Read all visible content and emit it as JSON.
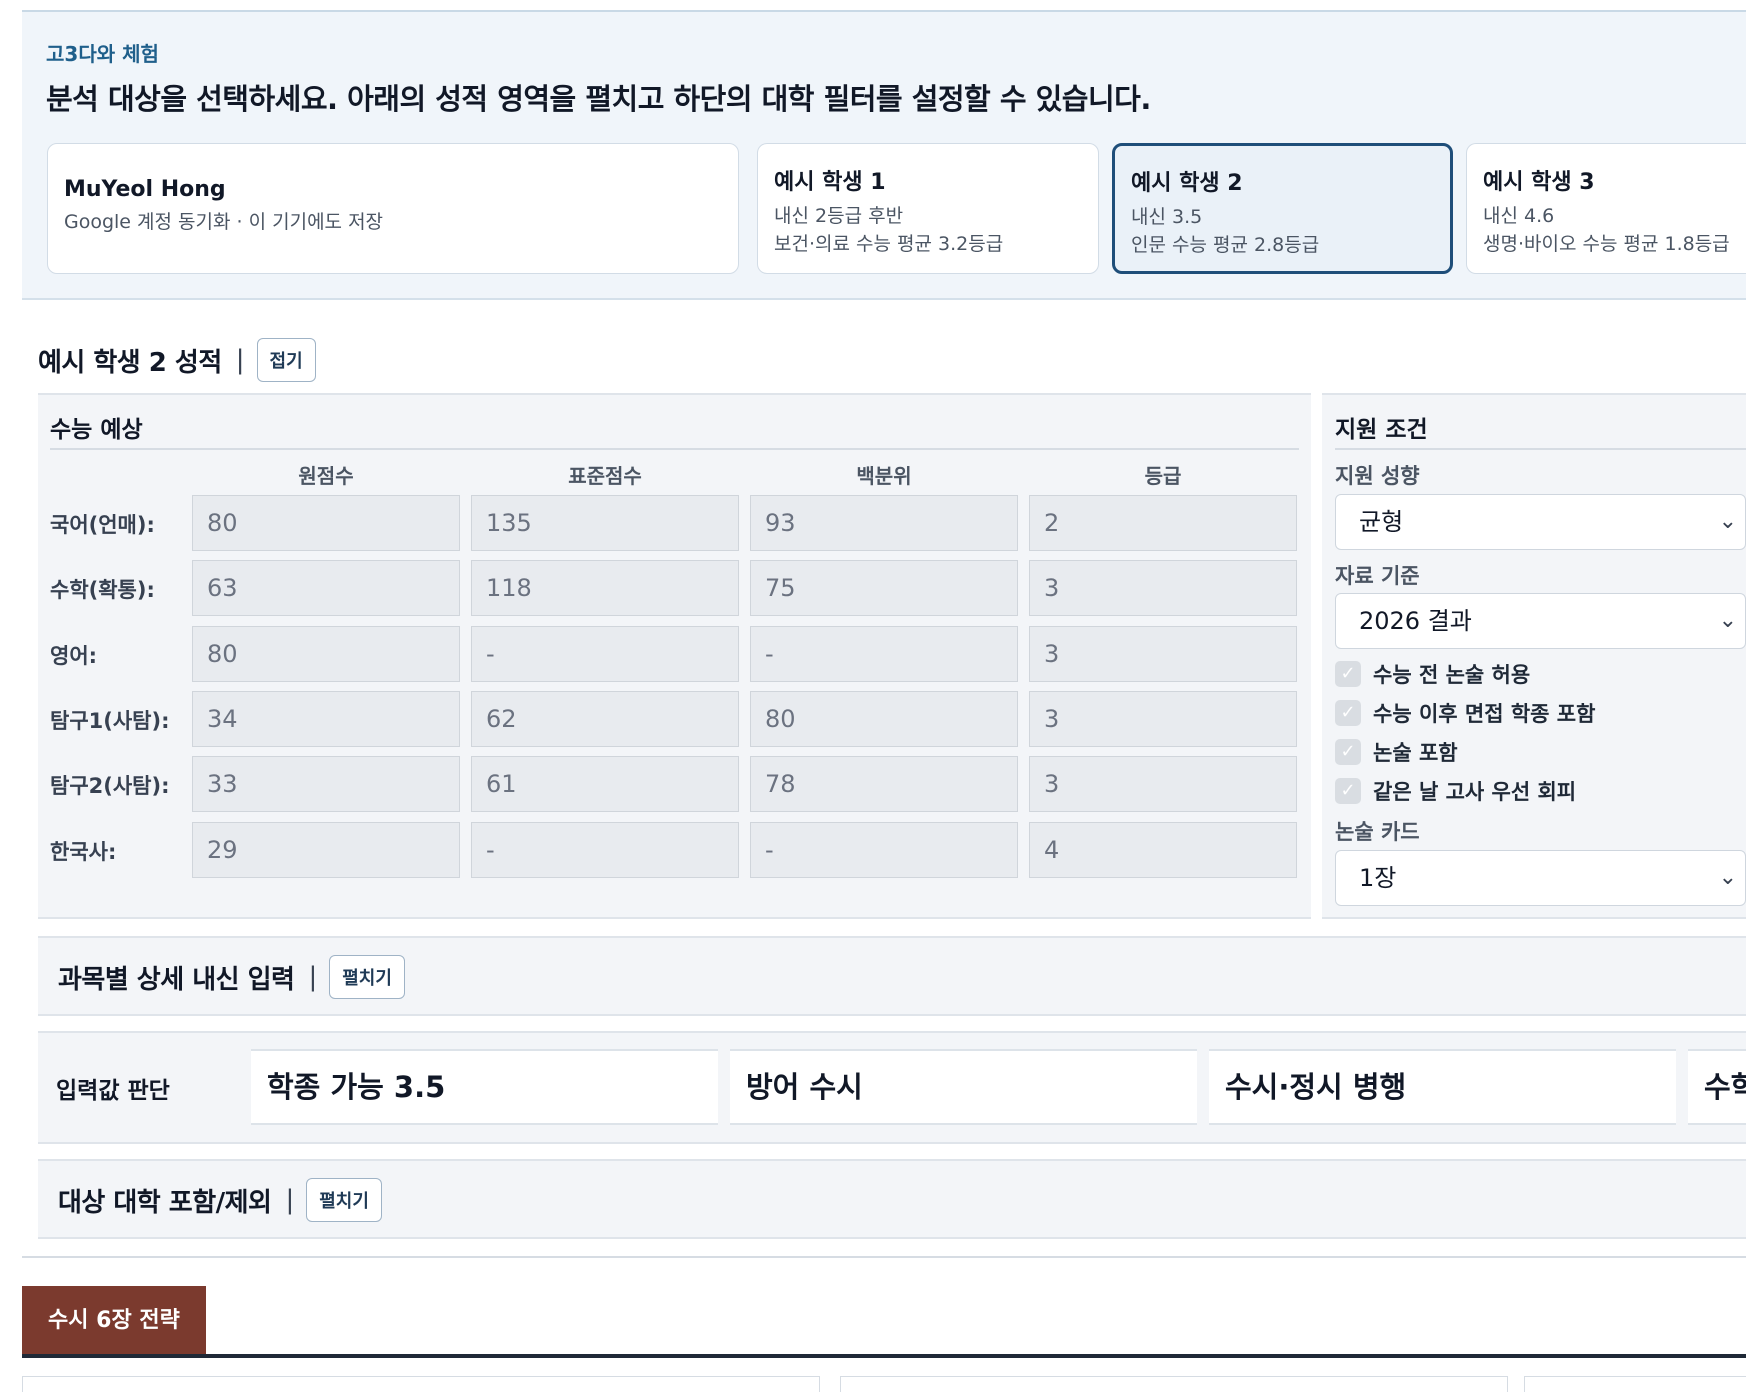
{
  "header": {
    "brand": "고3다와 체험",
    "headline": "분석 대상을 선택하세요. 아래의 성적 영역을 펼치고 하단의 대학 필터를 설정할 수 있습니다."
  },
  "students": [
    {
      "name": "MuYeol Hong",
      "lines": [
        "Google 계정 동기화 · 이 기기에도 저장"
      ],
      "selected": false
    },
    {
      "name": "예시 학생 1",
      "lines": [
        "내신 2등급 후반",
        "보건·의료 수능 평균 3.2등급"
      ],
      "selected": false
    },
    {
      "name": "예시 학생 2",
      "lines": [
        "내신 3.5",
        "인문 수능 평균 2.8등급"
      ],
      "selected": true
    },
    {
      "name": "예시 학생 3",
      "lines": [
        "내신 4.6",
        "생명·바이오 수능 평균 1.8등급"
      ],
      "selected": false
    }
  ],
  "grades": {
    "title": "예시 학생 2 성적",
    "separator": "|",
    "toggle_label": "접기",
    "csat": {
      "title": "수능 예상",
      "columns": [
        "원점수",
        "표준점수",
        "백분위",
        "등급"
      ],
      "rows": [
        {
          "label": "국어(언매):",
          "values": [
            "80",
            "135",
            "93",
            "2"
          ]
        },
        {
          "label": "수학(확통):",
          "values": [
            "63",
            "118",
            "75",
            "3"
          ]
        },
        {
          "label": "영어:",
          "values": [
            "80",
            "-",
            "-",
            "3"
          ]
        },
        {
          "label": "탐구1(사탐):",
          "values": [
            "34",
            "62",
            "80",
            "3"
          ]
        },
        {
          "label": "탐구2(사탐):",
          "values": [
            "33",
            "61",
            "78",
            "3"
          ]
        },
        {
          "label": "한국사:",
          "values": [
            "29",
            "-",
            "-",
            "4"
          ]
        }
      ]
    },
    "conditions": {
      "title": "지원 조건",
      "tendency_label": "지원 성향",
      "tendency_value": "균형",
      "basis_label": "자료 기준",
      "basis_value": "2026 결과",
      "checks": [
        {
          "label": "수능 전 논술 허용",
          "checked": true
        },
        {
          "label": "수능 이후 면접 학종 포함",
          "checked": true
        },
        {
          "label": "논술 포함",
          "checked": true
        },
        {
          "label": "같은 날 고사 우선 회피",
          "checked": true
        }
      ],
      "essay_card_label": "논술 카드",
      "essay_card_value": "1장"
    }
  },
  "detail_section": {
    "title": "과목별 상세 내신 입력",
    "separator": "|",
    "toggle_label": "펼치기"
  },
  "judgement": {
    "label": "입력값 판단",
    "items": [
      "학종 가능 3.5",
      "방어 수시",
      "수시·정시 병행",
      "수학"
    ]
  },
  "university_section": {
    "title": "대상 대학 포함/제외",
    "separator": "|",
    "toggle_label": "펼치기"
  },
  "tabs": {
    "active": "수시 6장 전략"
  },
  "icons": {
    "check": "check-icon",
    "chevron": "chevron-down-icon"
  },
  "colors": {
    "selected_border": "#1f4e79",
    "tab_active": "#7b3a2e",
    "brand": "#1f5f8b"
  }
}
